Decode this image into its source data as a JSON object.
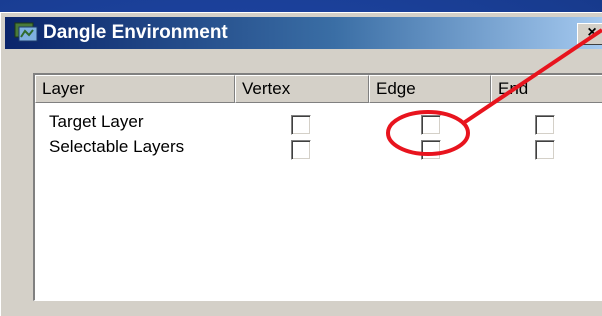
{
  "window": {
    "title": "Dangle Environment",
    "close_label": "×"
  },
  "table": {
    "columns": [
      "Layer",
      "Vertex",
      "Edge",
      "End"
    ],
    "rows": [
      {
        "label": "Target Layer",
        "vertex": false,
        "edge": false,
        "end": false
      },
      {
        "label": "Selectable Layers",
        "vertex": false,
        "edge": false,
        "end": false
      }
    ]
  },
  "annotation": {
    "color": "#e8141e",
    "icon": "highlight-ellipse-with-arrow"
  },
  "colors": {
    "titlebar_start": "#0a246a",
    "titlebar_end": "#a6caf0",
    "dialog_face": "#d4d0c8",
    "slide_background": "#1a3f95"
  }
}
